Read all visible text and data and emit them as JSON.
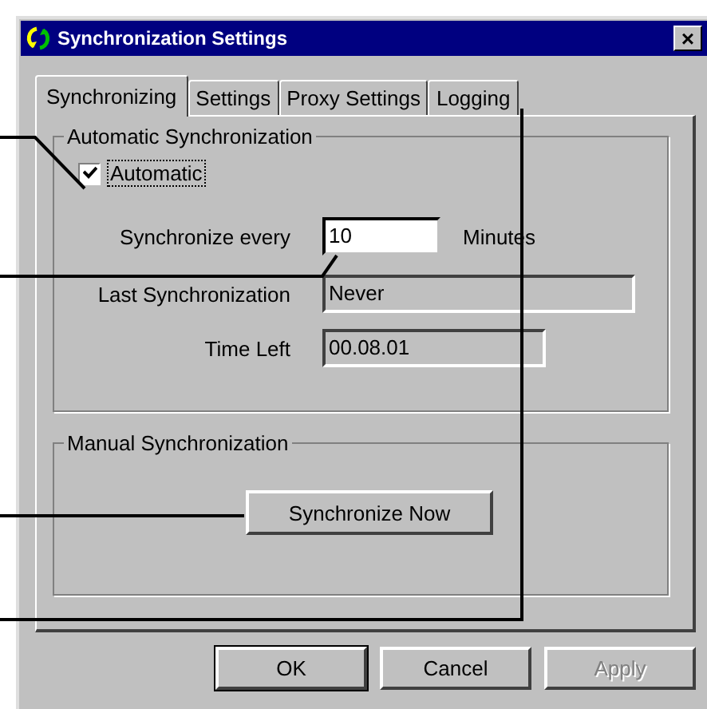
{
  "window": {
    "title": "Synchronization Settings",
    "close": "×"
  },
  "tabs": [
    {
      "label": "Synchronizing",
      "selected": true
    },
    {
      "label": "Settings",
      "selected": false
    },
    {
      "label": "Proxy Settings",
      "selected": false
    },
    {
      "label": "Logging",
      "selected": false
    }
  ],
  "automatic_group": {
    "title": "Automatic Synchronization",
    "checkbox": {
      "label": "Automatic",
      "checked": true
    },
    "interval": {
      "label": "Synchronize every",
      "value": "10",
      "unit": "Minutes"
    },
    "last_sync": {
      "label": "Last Synchronization",
      "value": "Never"
    },
    "time_left": {
      "label": "Time Left",
      "value": "00.08.01"
    }
  },
  "manual_group": {
    "title": "Manual Synchronization",
    "button": "Synchronize Now"
  },
  "buttons": [
    {
      "label": "OK",
      "disabled": false,
      "default": true
    },
    {
      "label": "Cancel",
      "disabled": false,
      "default": false
    },
    {
      "label": "Apply",
      "disabled": true,
      "default": false
    }
  ]
}
